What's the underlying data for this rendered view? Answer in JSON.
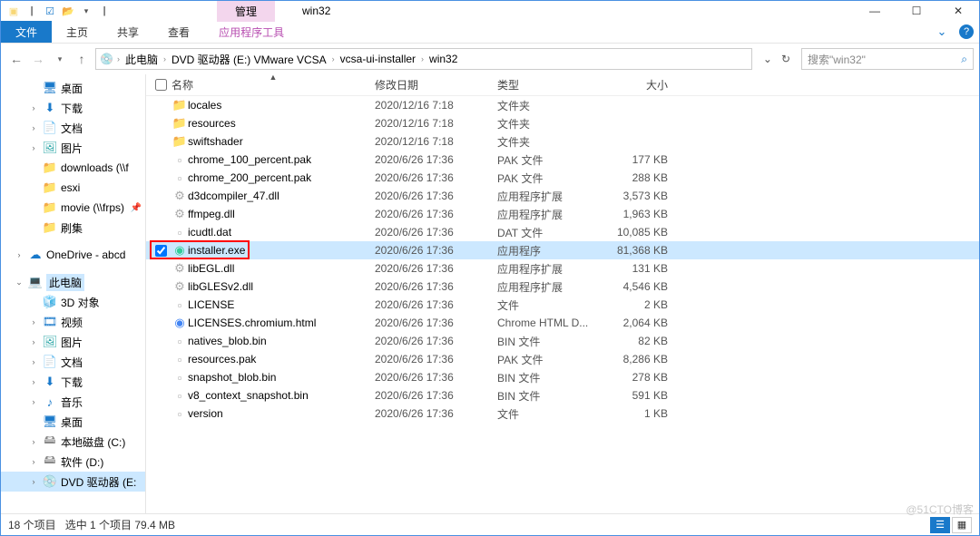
{
  "window": {
    "title": "win32",
    "tool_tab": "管理",
    "controls": {
      "min": "—",
      "max": "☐",
      "close": "✕"
    }
  },
  "ribbon": {
    "file": "文件",
    "tabs": [
      "主页",
      "共享",
      "查看"
    ],
    "context_tab": "应用程序工具",
    "help": "?"
  },
  "address": {
    "nav": {
      "back": "←",
      "fwd": "→",
      "up": "↑"
    },
    "crumbs": [
      "此电脑",
      "DVD 驱动器 (E:) VMware VCSA",
      "vcsa-ui-installer",
      "win32"
    ],
    "refresh": "↻",
    "dropdown": "⌄",
    "search_placeholder": "搜索\"win32\""
  },
  "columns": {
    "name": "名称",
    "date": "修改日期",
    "type": "类型",
    "size": "大小",
    "sort": "▲"
  },
  "tree": [
    {
      "lvl": 2,
      "icon": "🖥",
      "cls": "i-desk",
      "label": "桌面"
    },
    {
      "lvl": 2,
      "icon": "⬇",
      "cls": "i-down",
      "label": "下载",
      "exp": "›"
    },
    {
      "lvl": 2,
      "icon": "📄",
      "cls": "i-doc",
      "label": "文档",
      "exp": "›"
    },
    {
      "lvl": 2,
      "icon": "🖼",
      "cls": "i-pic",
      "label": "图片",
      "exp": "›"
    },
    {
      "lvl": 2,
      "icon": "📁",
      "cls": "i-folder",
      "label": "downloads (\\\\f"
    },
    {
      "lvl": 2,
      "icon": "📁",
      "cls": "i-folder",
      "label": "esxi"
    },
    {
      "lvl": 2,
      "icon": "📁",
      "cls": "i-folder",
      "label": "movie (\\\\frps)",
      "pin": "📌"
    },
    {
      "lvl": 2,
      "icon": "📁",
      "cls": "i-folder",
      "label": "刷集"
    },
    {
      "spacer": true
    },
    {
      "lvl": 1,
      "icon": "☁",
      "cls": "i-cloud",
      "label": "OneDrive - abcd",
      "exp": "›"
    },
    {
      "spacer": true
    },
    {
      "lvl": 1,
      "icon": "💻",
      "cls": "i-pc",
      "label": "此电脑",
      "exp": "⌄",
      "sel": true
    },
    {
      "lvl": 2,
      "icon": "🧊",
      "cls": "i-3d",
      "label": "3D 对象"
    },
    {
      "lvl": 2,
      "icon": "🎞",
      "cls": "i-vid",
      "label": "视频",
      "exp": "›"
    },
    {
      "lvl": 2,
      "icon": "🖼",
      "cls": "i-pic",
      "label": "图片",
      "exp": "›"
    },
    {
      "lvl": 2,
      "icon": "📄",
      "cls": "i-doc",
      "label": "文档",
      "exp": "›"
    },
    {
      "lvl": 2,
      "icon": "⬇",
      "cls": "i-down",
      "label": "下载",
      "exp": "›"
    },
    {
      "lvl": 2,
      "icon": "♪",
      "cls": "i-music",
      "label": "音乐",
      "exp": "›"
    },
    {
      "lvl": 2,
      "icon": "🖥",
      "cls": "i-desk",
      "label": "桌面"
    },
    {
      "lvl": 2,
      "icon": "🖴",
      "cls": "i-drv",
      "label": "本地磁盘 (C:)",
      "exp": "›"
    },
    {
      "lvl": 2,
      "icon": "🖴",
      "cls": "i-drv",
      "label": "软件 (D:)",
      "exp": "›"
    },
    {
      "lvl": 2,
      "icon": "💿",
      "cls": "i-disc",
      "label": "DVD 驱动器 (E:",
      "exp": "›",
      "sel2": true
    }
  ],
  "files": [
    {
      "icon": "📁",
      "cls": "i-folder2",
      "name": "locales",
      "date": "2020/12/16 7:18",
      "type": "文件夹",
      "size": ""
    },
    {
      "icon": "📁",
      "cls": "i-folder2",
      "name": "resources",
      "date": "2020/12/16 7:18",
      "type": "文件夹",
      "size": ""
    },
    {
      "icon": "📁",
      "cls": "i-folder2",
      "name": "swiftshader",
      "date": "2020/12/16 7:18",
      "type": "文件夹",
      "size": ""
    },
    {
      "icon": "▫",
      "cls": "i-file",
      "name": "chrome_100_percent.pak",
      "date": "2020/6/26 17:36",
      "type": "PAK 文件",
      "size": "177 KB"
    },
    {
      "icon": "▫",
      "cls": "i-file",
      "name": "chrome_200_percent.pak",
      "date": "2020/6/26 17:36",
      "type": "PAK 文件",
      "size": "288 KB"
    },
    {
      "icon": "⚙",
      "cls": "i-file",
      "name": "d3dcompiler_47.dll",
      "date": "2020/6/26 17:36",
      "type": "应用程序扩展",
      "size": "3,573 KB"
    },
    {
      "icon": "⚙",
      "cls": "i-file",
      "name": "ffmpeg.dll",
      "date": "2020/6/26 17:36",
      "type": "应用程序扩展",
      "size": "1,963 KB"
    },
    {
      "icon": "▫",
      "cls": "i-file",
      "name": "icudtl.dat",
      "date": "2020/6/26 17:36",
      "type": "DAT 文件",
      "size": "10,085 KB"
    },
    {
      "icon": "◉",
      "cls": "i-app",
      "name": "installer.exe",
      "date": "2020/6/26 17:36",
      "type": "应用程序",
      "size": "81,368 KB",
      "sel": true,
      "annot": true
    },
    {
      "icon": "⚙",
      "cls": "i-file",
      "name": "libEGL.dll",
      "date": "2020/6/26 17:36",
      "type": "应用程序扩展",
      "size": "131 KB"
    },
    {
      "icon": "⚙",
      "cls": "i-file",
      "name": "libGLESv2.dll",
      "date": "2020/6/26 17:36",
      "type": "应用程序扩展",
      "size": "4,546 KB"
    },
    {
      "icon": "▫",
      "cls": "i-file",
      "name": "LICENSE",
      "date": "2020/6/26 17:36",
      "type": "文件",
      "size": "2 KB"
    },
    {
      "icon": "◉",
      "cls": "i-chrome",
      "name": "LICENSES.chromium.html",
      "date": "2020/6/26 17:36",
      "type": "Chrome HTML D...",
      "size": "2,064 KB"
    },
    {
      "icon": "▫",
      "cls": "i-file",
      "name": "natives_blob.bin",
      "date": "2020/6/26 17:36",
      "type": "BIN 文件",
      "size": "82 KB"
    },
    {
      "icon": "▫",
      "cls": "i-file",
      "name": "resources.pak",
      "date": "2020/6/26 17:36",
      "type": "PAK 文件",
      "size": "8,286 KB"
    },
    {
      "icon": "▫",
      "cls": "i-file",
      "name": "snapshot_blob.bin",
      "date": "2020/6/26 17:36",
      "type": "BIN 文件",
      "size": "278 KB"
    },
    {
      "icon": "▫",
      "cls": "i-file",
      "name": "v8_context_snapshot.bin",
      "date": "2020/6/26 17:36",
      "type": "BIN 文件",
      "size": "591 KB"
    },
    {
      "icon": "▫",
      "cls": "i-file",
      "name": "version",
      "date": "2020/6/26 17:36",
      "type": "文件",
      "size": "1 KB"
    }
  ],
  "status": {
    "count": "18 个项目",
    "selected": "选中 1 个项目  79.4 MB"
  },
  "watermark": "@51CTO博客"
}
